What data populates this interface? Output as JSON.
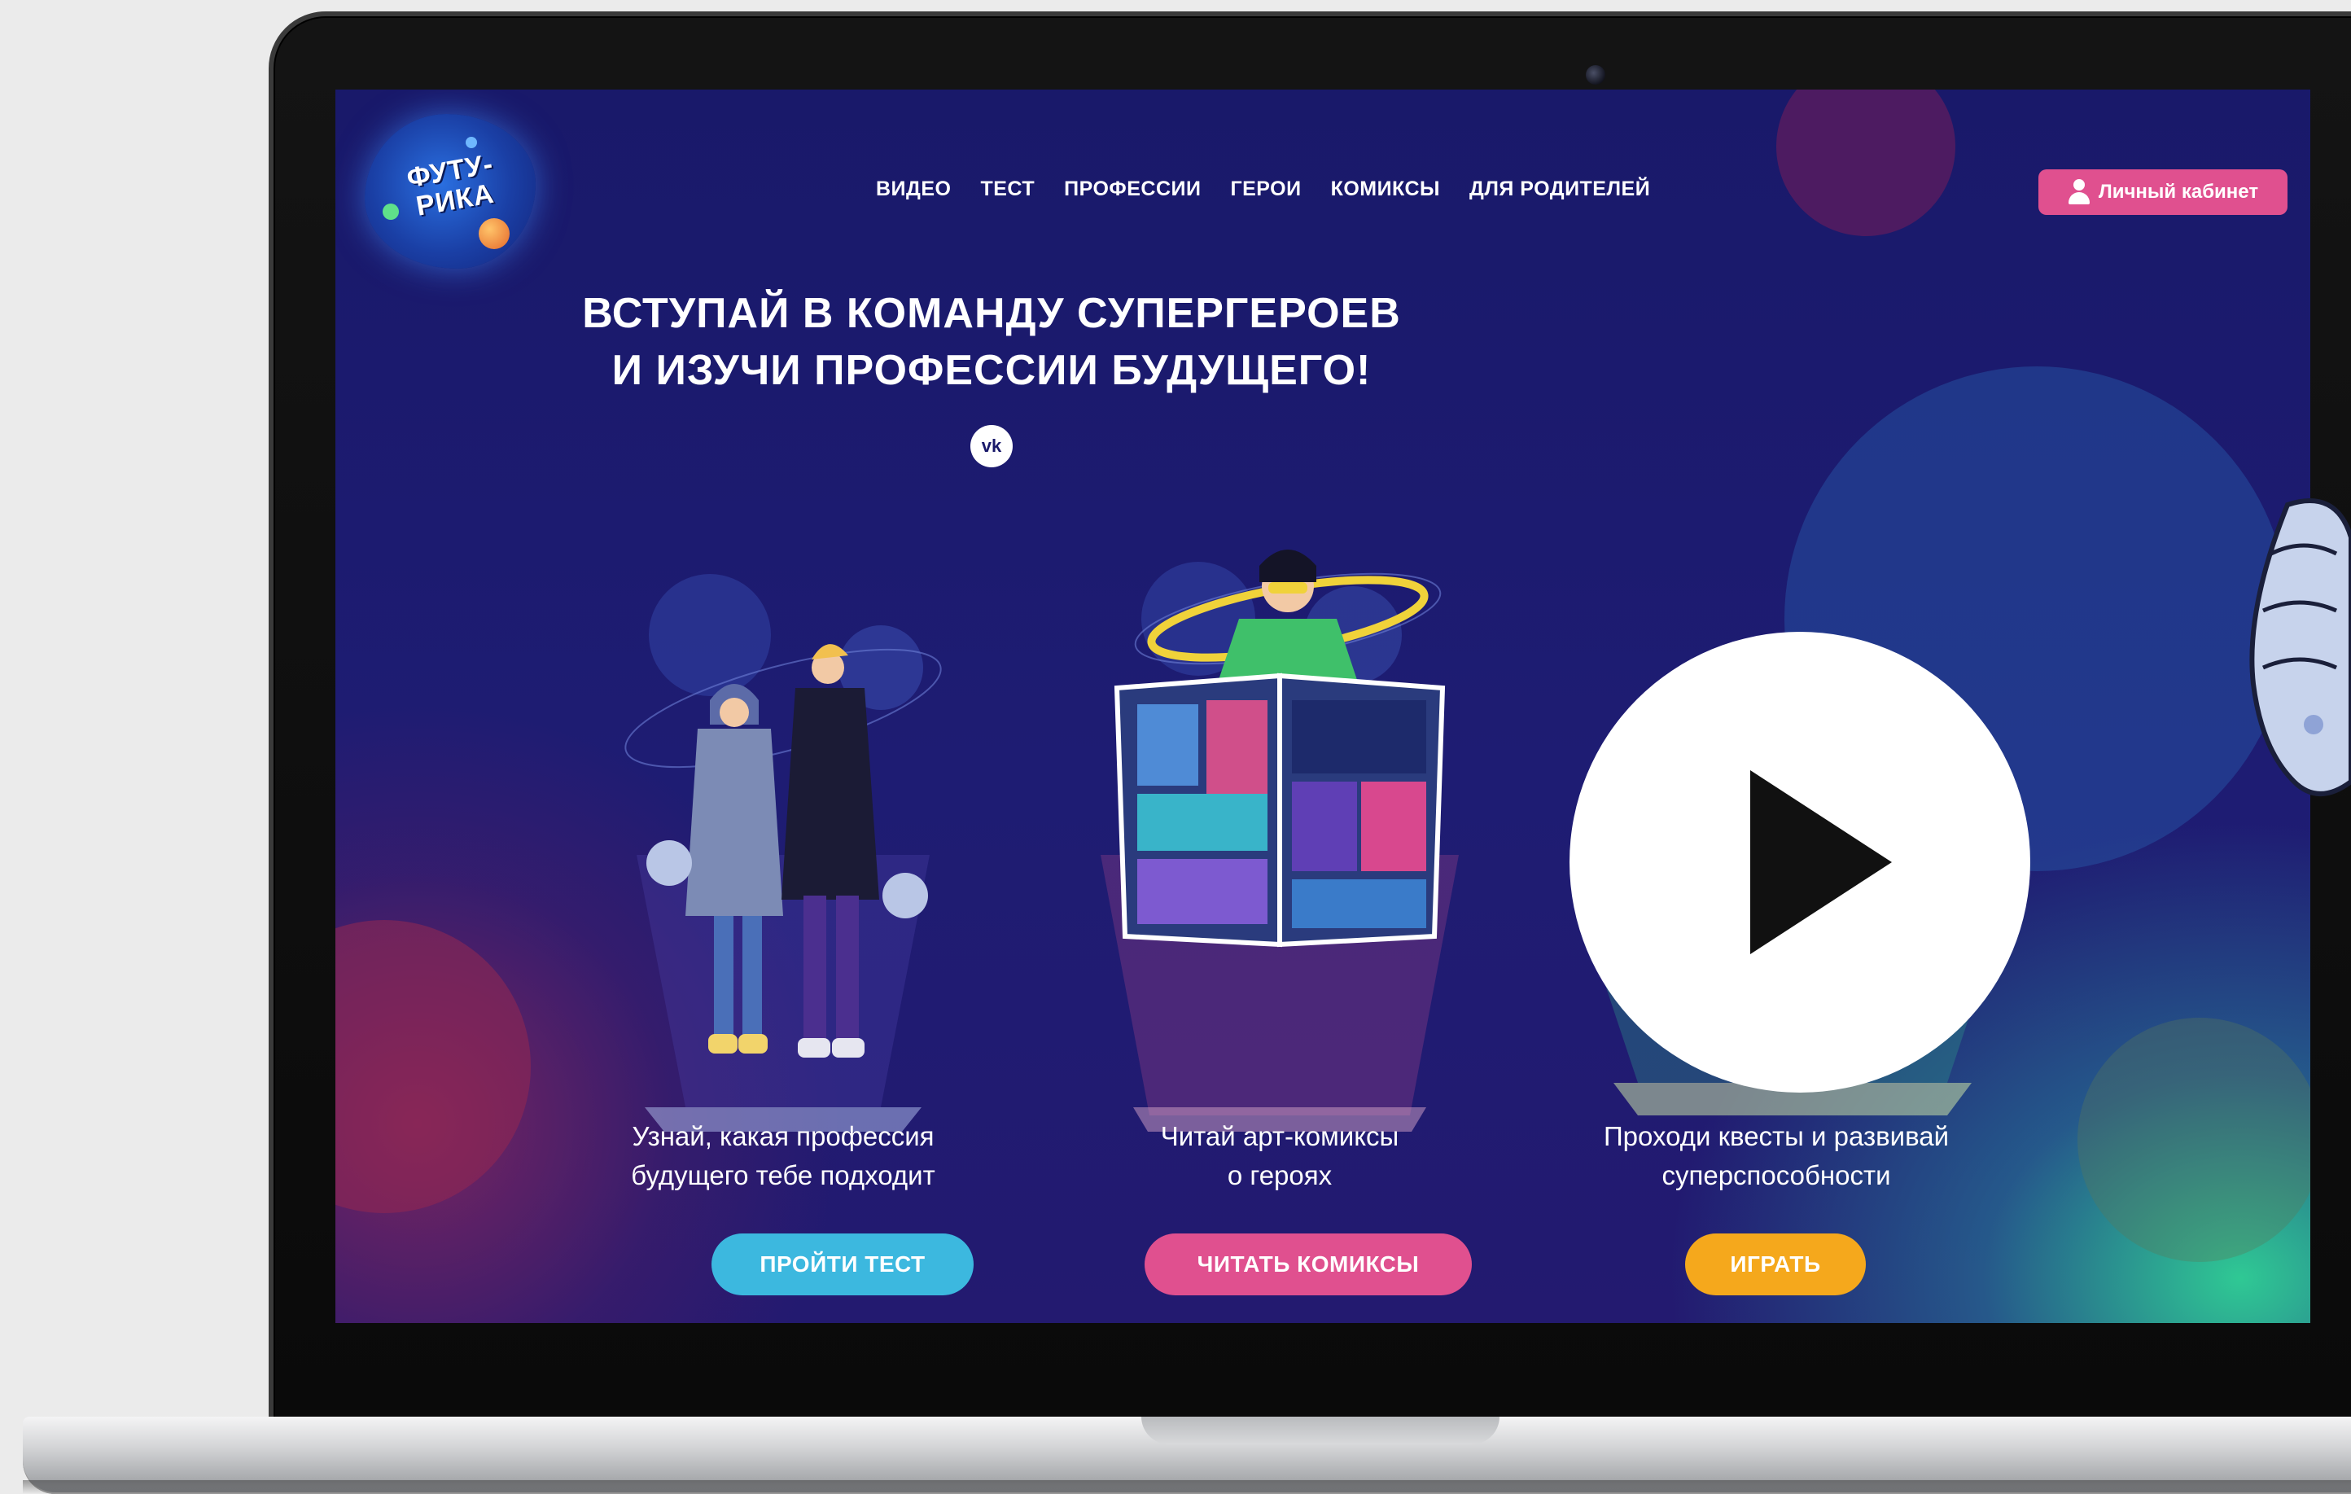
{
  "logo": {
    "line1": "ФУТУ-",
    "line2": "РИКА"
  },
  "nav": {
    "items": [
      {
        "label": "ВИДЕО"
      },
      {
        "label": "ТЕСТ"
      },
      {
        "label": "ПРОФЕССИИ"
      },
      {
        "label": "ГЕРОИ"
      },
      {
        "label": "КОМИКСЫ"
      },
      {
        "label": "ДЛЯ РОДИТЕЛЕЙ"
      }
    ]
  },
  "account": {
    "label": "Личный кабинет",
    "icon": "user-icon"
  },
  "hero": {
    "line1": "ВСТУПАЙ В КОМАНДУ СУПЕРГЕРОЕВ",
    "line2": "И ИЗУЧИ ПРОФЕССИИ БУДУЩЕГО!",
    "social_icon": "vk-icon",
    "social_label": "vk"
  },
  "cards": [
    {
      "text_line1": "Узнай, какая профессия",
      "text_line2": "будущего тебе подходит",
      "button": "ПРОЙТИ ТЕСТ",
      "color": "#3cb8df"
    },
    {
      "text_line1": "Читай арт-комиксы",
      "text_line2": "о героях",
      "button": "ЧИТАТЬ КОМИКСЫ",
      "color": "#e0508f"
    },
    {
      "text_line1": "Проходи квесты и развивай",
      "text_line2": "суперспособности",
      "button": "ИГРАТЬ",
      "color": "#f5a81c"
    }
  ],
  "video_overlay": {
    "icon": "play-icon"
  },
  "colors": {
    "background": "#ebebeb",
    "screen_bg": "#19196a",
    "accent_pink": "#e0508f",
    "accent_blue": "#3cb8df",
    "accent_orange": "#f5a81c"
  }
}
